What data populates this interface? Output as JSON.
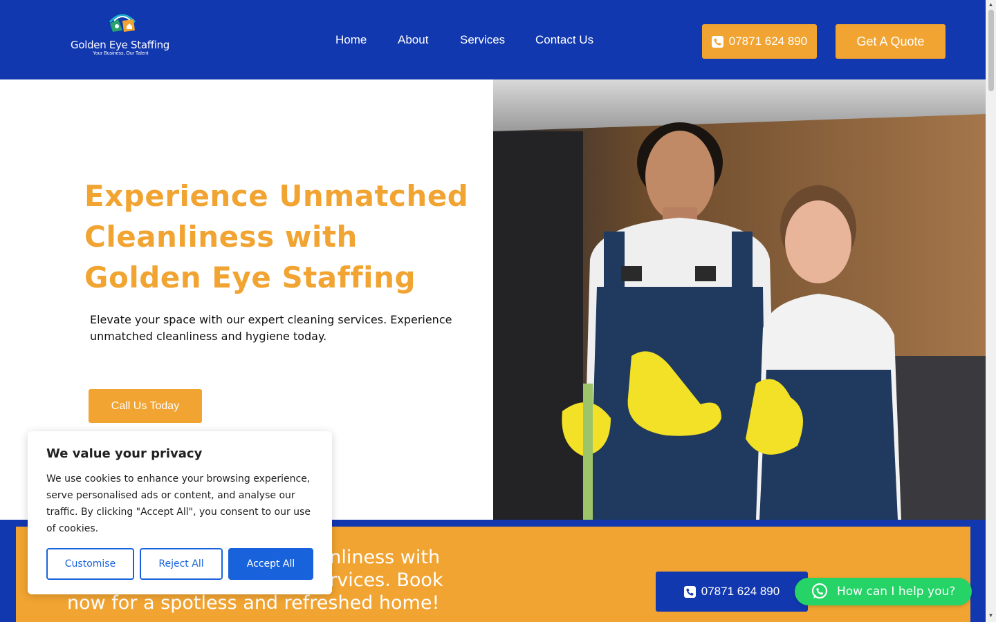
{
  "header": {
    "logo": {
      "name": "Golden Eye Staffing",
      "tagline": "Your Business, Our Talent"
    },
    "nav": [
      {
        "label": "Home"
      },
      {
        "label": "About"
      },
      {
        "label": "Services"
      },
      {
        "label": "Contact Us"
      }
    ],
    "phone_label": "07871 624 890",
    "quote_label": "Get A Quote"
  },
  "hero": {
    "title": "Experience Unmatched Cleanliness with Golden Eye Staffing",
    "subtitle": "Elevate your space with our expert cleaning services. Experience unmatched cleanliness and hygiene today.",
    "cta_label": "Call Us Today",
    "image_icon": "cleaners-photo"
  },
  "band": {
    "text": "Experience exceptional cleanliness with our professional cleaning services. Book now for a spotless and refreshed home!",
    "phone_label": "07871 624 890"
  },
  "whatsapp": {
    "label": "How can I help you?",
    "icon": "whatsapp-icon"
  },
  "cookie": {
    "title": "We value your privacy",
    "body": "We use cookies to enhance your browsing experience, serve personalised ads or content, and analyse our traffic. By clicking \"Accept All\", you consent to our use of cookies.",
    "customise": "Customise",
    "reject": "Reject All",
    "accept": "Accept All"
  },
  "colors": {
    "brand_blue": "#1238b0",
    "brand_orange": "#f1a431",
    "cookie_blue": "#1863dc",
    "whatsapp_green": "#25d366"
  }
}
